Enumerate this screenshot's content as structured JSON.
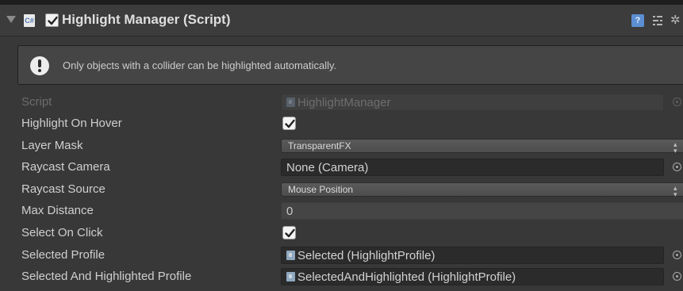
{
  "header": {
    "title": "Highlight Manager (Script)",
    "script_icon_text": "C#",
    "enabled": true,
    "help_icon_text": "?",
    "gear_glyph": "✲"
  },
  "helpbox": {
    "message": "Only objects with a collider can be highlighted automatically."
  },
  "fields": {
    "script": {
      "label": "Script",
      "value": "HighlightManager"
    },
    "highlight_on_hover": {
      "label": "Highlight On Hover",
      "checked": true
    },
    "layer_mask": {
      "label": "Layer Mask",
      "value": "TransparentFX"
    },
    "raycast_camera": {
      "label": "Raycast Camera",
      "value": "None (Camera)"
    },
    "raycast_source": {
      "label": "Raycast Source",
      "value": "Mouse Position"
    },
    "max_distance": {
      "label": "Max Distance",
      "value": "0"
    },
    "select_on_click": {
      "label": "Select On Click",
      "checked": true
    },
    "selected_profile": {
      "label": "Selected Profile",
      "value": "Selected (HighlightProfile)"
    },
    "selected_and_highlighted_profile": {
      "label": "Selected And Highlighted Profile",
      "value": "SelectedAndHighlighted (HighlightProfile)"
    }
  },
  "glyphs": {
    "popup_arrows": "▲▼"
  },
  "colors": {
    "background": "#383838",
    "field_dark": "#2b2b2b",
    "help_blue": "#5b8fd1"
  }
}
